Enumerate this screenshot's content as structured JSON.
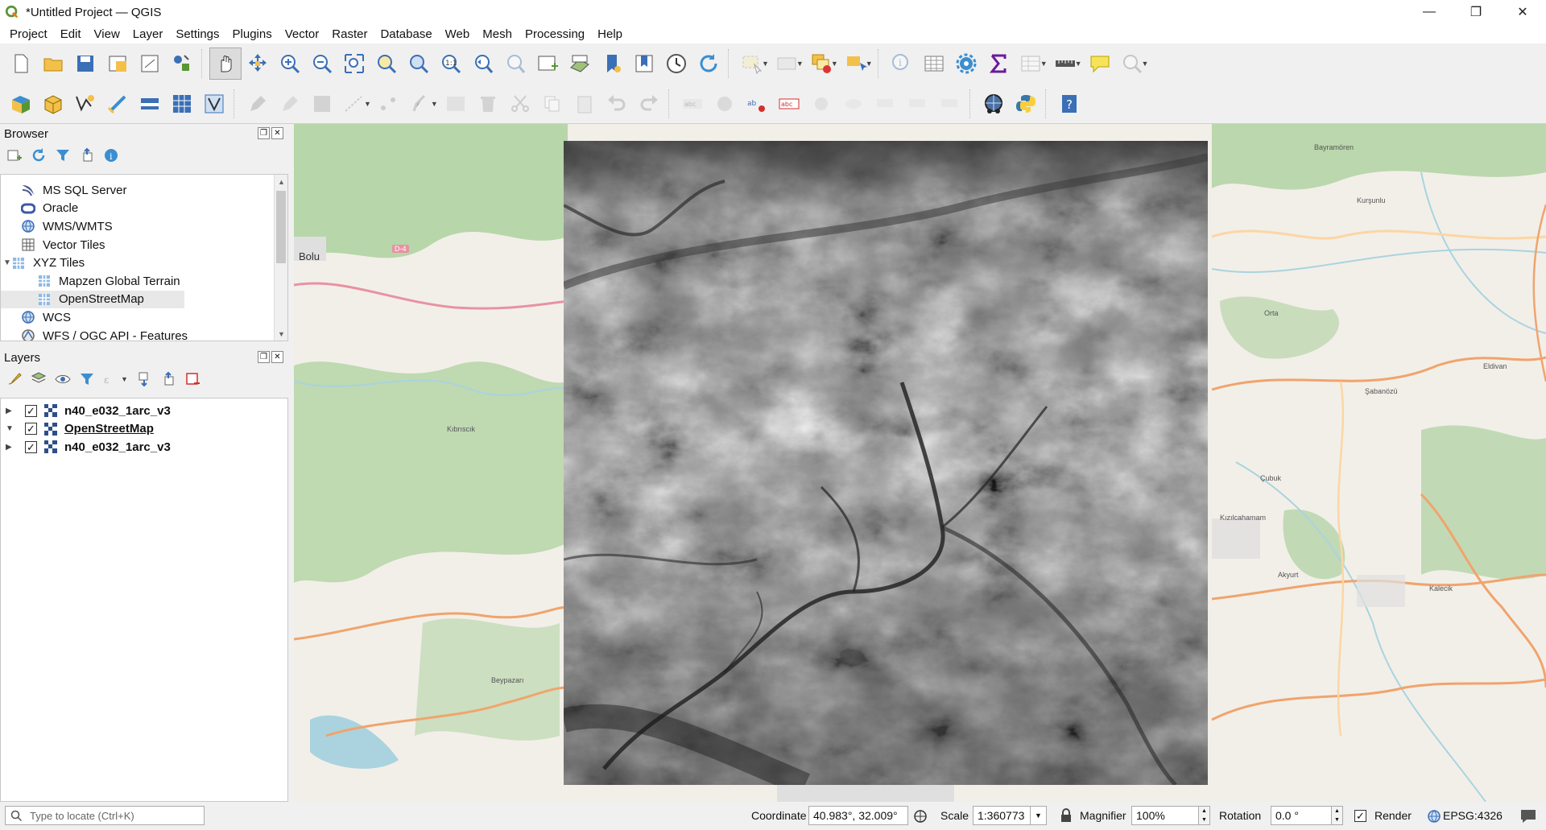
{
  "window": {
    "title": "*Untitled Project — QGIS",
    "minimize": "—",
    "maximize": "❐",
    "close": "✕"
  },
  "menu": [
    "Project",
    "Edit",
    "View",
    "Layer",
    "Settings",
    "Plugins",
    "Vector",
    "Raster",
    "Database",
    "Web",
    "Mesh",
    "Processing",
    "Help"
  ],
  "browser": {
    "title": "Browser",
    "items": [
      {
        "label": "MS SQL Server",
        "icon": "mssql-icon"
      },
      {
        "label": "Oracle",
        "icon": "oracle-icon"
      },
      {
        "label": "WMS/WMTS",
        "icon": "wms-globe-icon"
      },
      {
        "label": "Vector Tiles",
        "icon": "vector-tiles-icon"
      },
      {
        "label": "XYZ Tiles",
        "icon": "xyz-tiles-icon"
      },
      {
        "label": "Mapzen Global Terrain",
        "icon": "xyz-tile-layer-icon"
      },
      {
        "label": "OpenStreetMap",
        "icon": "xyz-tile-layer-icon"
      },
      {
        "label": "WCS",
        "icon": "wcs-globe-icon"
      },
      {
        "label": "WFS / OGC API - Features",
        "icon": "wfs-globe-icon"
      }
    ]
  },
  "layers": {
    "title": "Layers",
    "items": [
      {
        "label": "n40_e032_1arc_v3",
        "checked": "✓"
      },
      {
        "label": "OpenStreetMap",
        "checked": "✓"
      },
      {
        "label": "n40_e032_1arc_v3",
        "checked": "✓"
      }
    ]
  },
  "map": {
    "labels": {
      "bolu": "Bolu",
      "kibriscik": "Kıbrıscık",
      "beypazari": "Beypazarı",
      "bayramoren": "Bayramören",
      "kursunlu": "Kurşunlu",
      "orta": "Orta",
      "sabanozu": "Şabanözü",
      "eldivan": "Eldivan",
      "kizilcahamam": "Kızılcahamam",
      "akyurt": "Akyurt",
      "kalecik": "Kalecik",
      "cubuk": "Çubuk",
      "road_d4": "D-4"
    }
  },
  "status": {
    "locator_placeholder": "Type to locate (Ctrl+K)",
    "coordinate_label": "Coordinate",
    "coordinate_value": "40.983°, 32.009°",
    "scale_label": "Scale",
    "scale_value": "1:360773",
    "magnifier_label": "Magnifier",
    "magnifier_value": "100%",
    "rotation_label": "Rotation",
    "rotation_value": "0.0 °",
    "render_label": "Render",
    "render_checked": "✓",
    "crs": "EPSG:4326"
  }
}
